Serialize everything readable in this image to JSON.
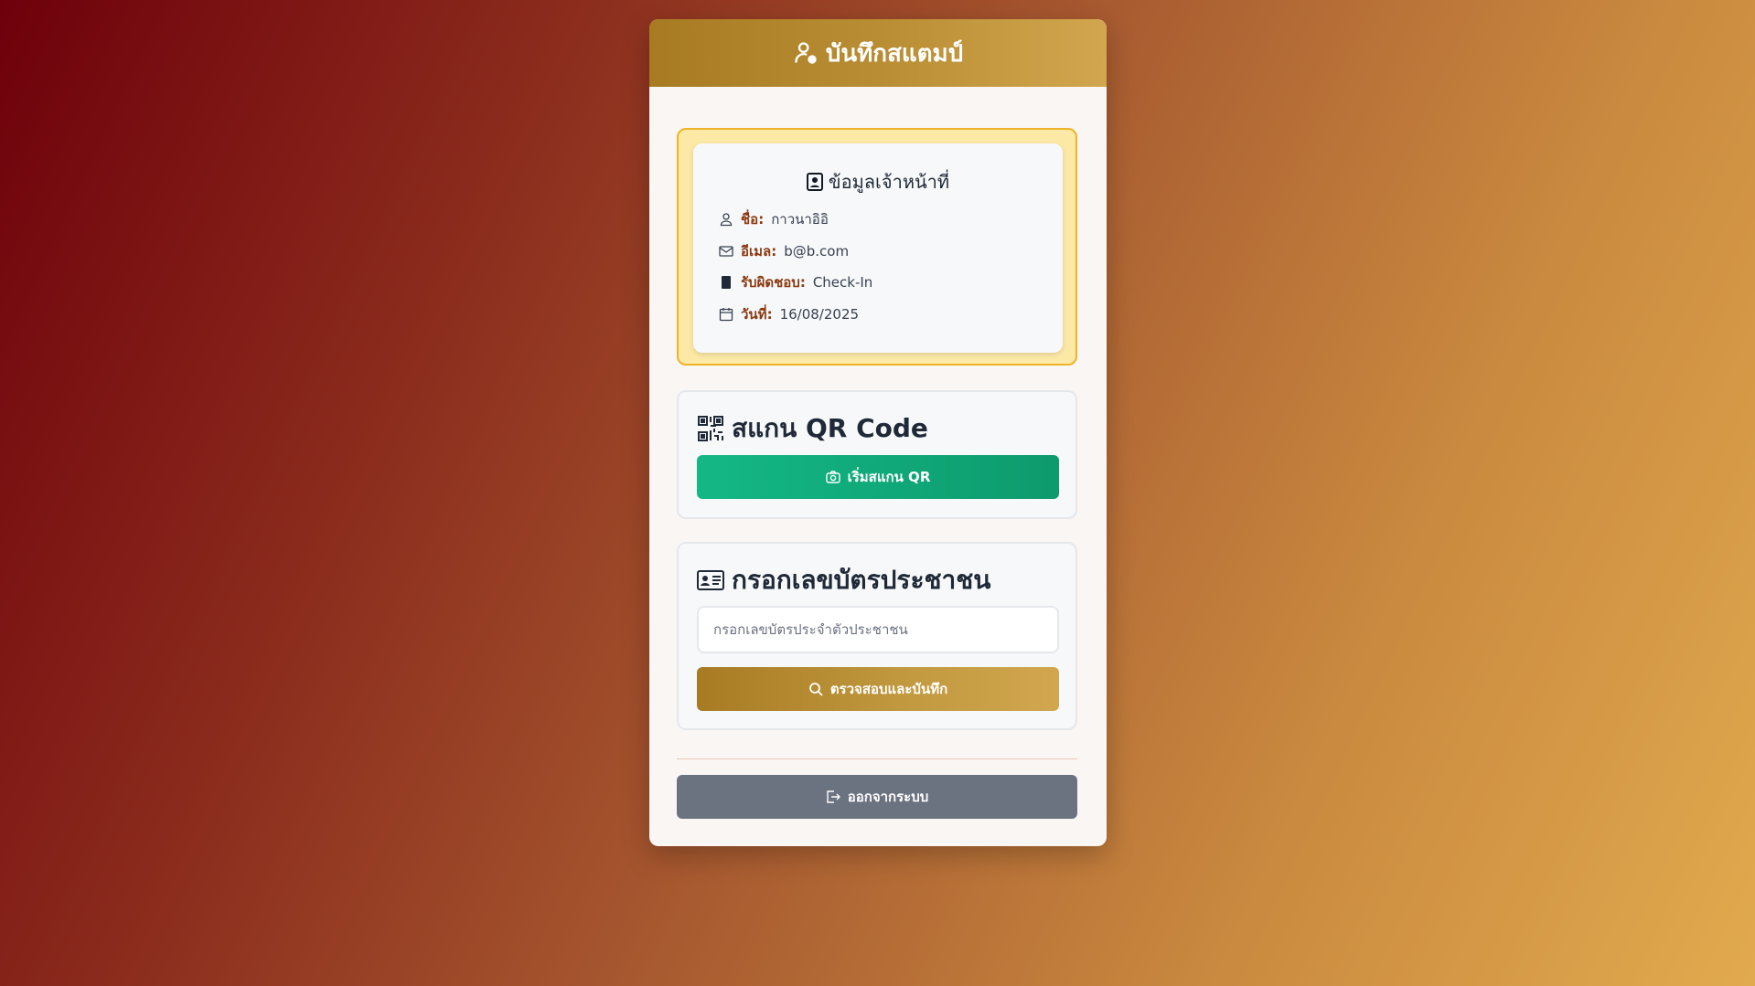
{
  "header": {
    "title": "บันทึกสแตมป์",
    "icon": "user-gear-icon"
  },
  "officer": {
    "title": "ข้อมูลเจ้าหน้าที่",
    "name_label": "ชื่อ:",
    "name_value": "กาวนาอิอิ",
    "email_label": "อีเมล:",
    "email_value": "b@b.com",
    "duty_label": "รับผิดชอบ:",
    "duty_value": "Check-In",
    "date_label": "วันที่:",
    "date_value": "16/08/2025"
  },
  "qr_section": {
    "title": "สแกน QR Code",
    "button_label": "เริ่มสแกน QR"
  },
  "id_section": {
    "title": "กรอกเลขบัตรประชาชน",
    "input_placeholder": "กรอกเลขบัตรประจำตัวประชาชน",
    "input_value": "",
    "button_label": "ตรวจสอบและบันทึก"
  },
  "logout": {
    "button_label": "ออกจากระบบ"
  },
  "colors": {
    "accent_gold": "#b88d33",
    "scan_green": "#14b885",
    "logout_gray": "#6b7280",
    "label_brown": "#8a3a10"
  }
}
